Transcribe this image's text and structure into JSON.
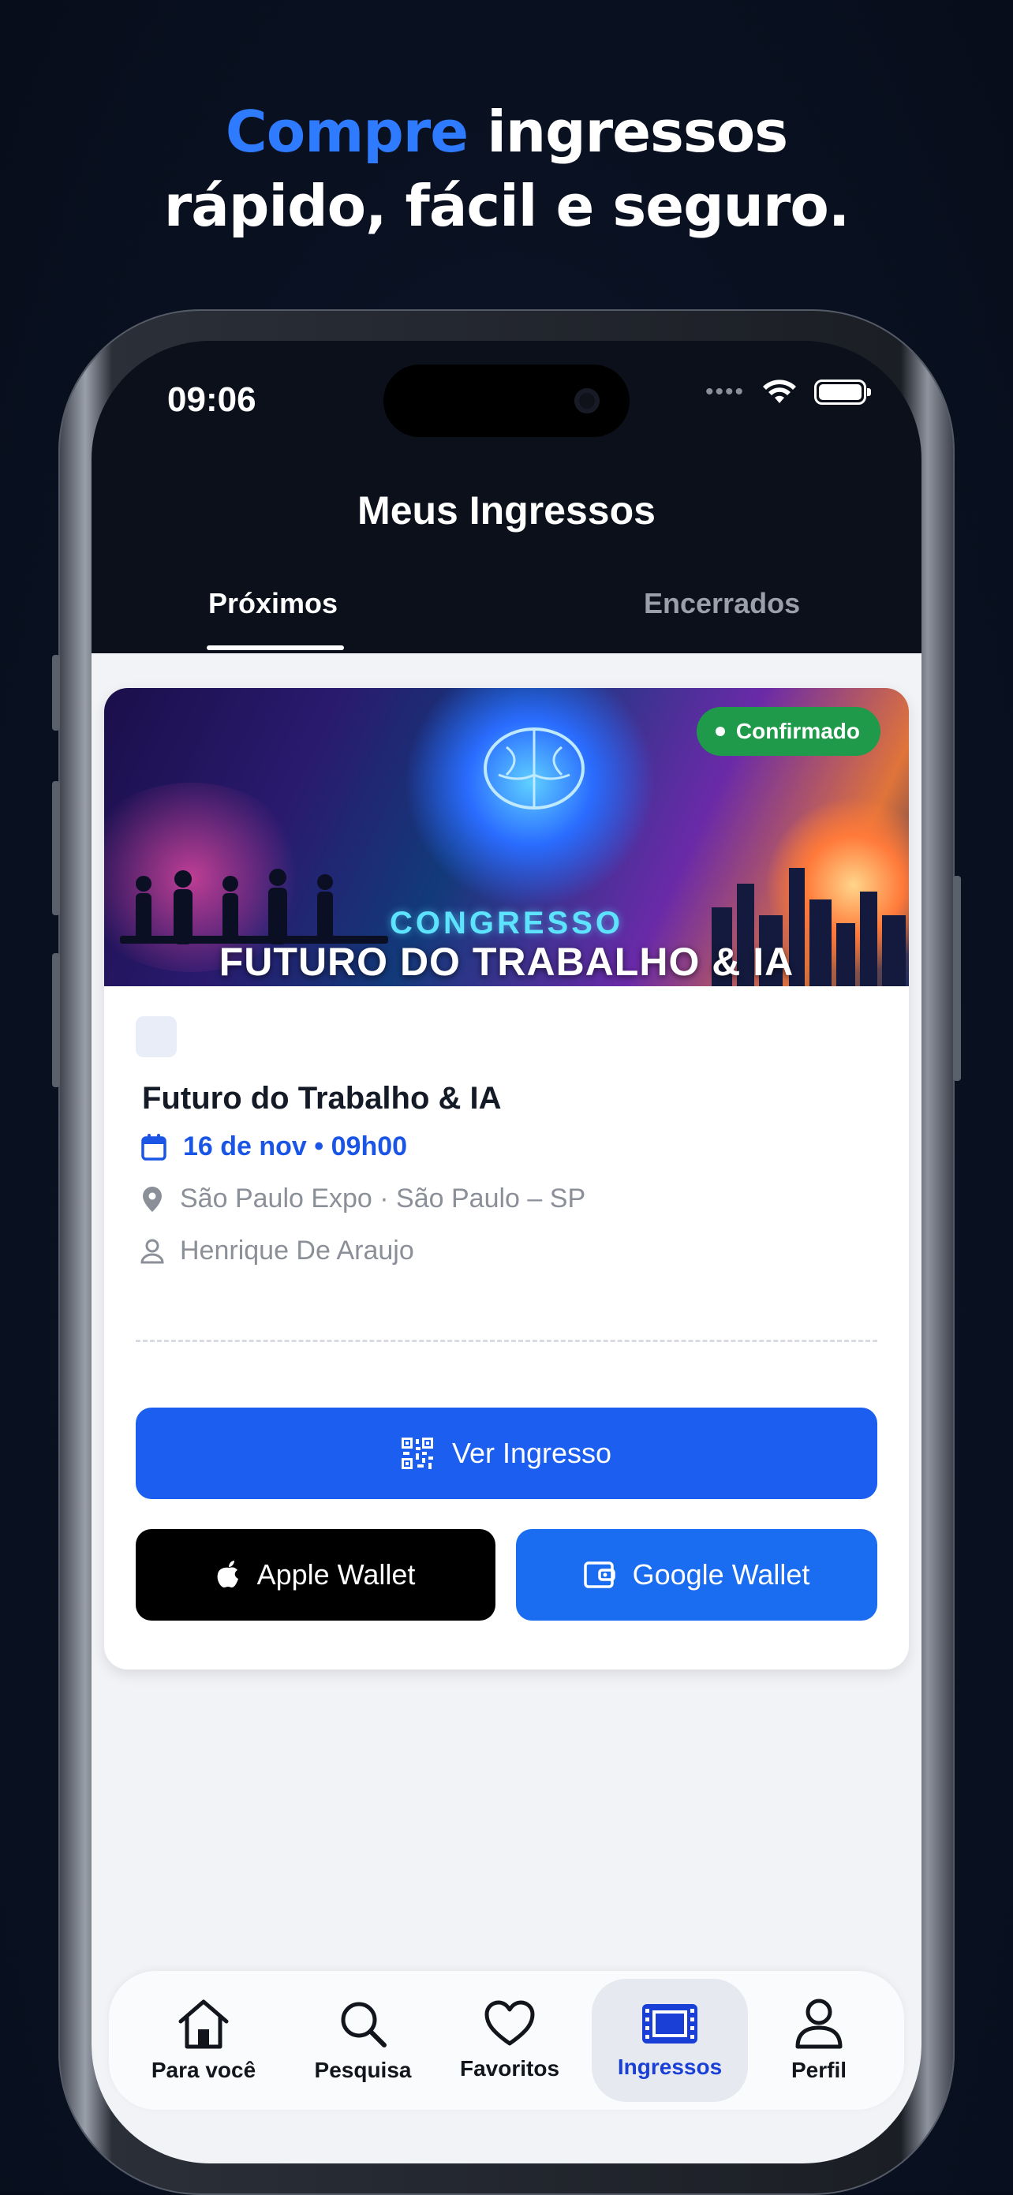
{
  "headline": {
    "accent": "Compre",
    "line1_rest": " ingressos",
    "line2": "rápido, fácil e seguro."
  },
  "status_bar": {
    "time": "09:06"
  },
  "header": {
    "title": "Meus Ingressos"
  },
  "tabs": [
    {
      "label": "Próximos",
      "active": true
    },
    {
      "label": "Encerrados",
      "active": false
    }
  ],
  "ticket": {
    "status": "Confirmado",
    "banner_subtitle": "CONGRESSO",
    "banner_title": "FUTURO DO TRABALHO & IA",
    "title": "Futuro do Trabalho & IA",
    "date": "16 de nov • 09h00",
    "venue": "São Paulo Expo · São Paulo – SP",
    "holder": "Henrique De Araujo",
    "view_ticket_label": "Ver Ingresso",
    "apple_wallet_label": "Apple Wallet",
    "google_wallet_label": "Google Wallet"
  },
  "nav": [
    {
      "label": "Para você",
      "icon": "home-icon"
    },
    {
      "label": "Pesquisa",
      "icon": "search-icon"
    },
    {
      "label": "Favoritos",
      "icon": "heart-icon"
    },
    {
      "label": "Ingressos",
      "icon": "ticket-icon",
      "active": true
    },
    {
      "label": "Perfil",
      "icon": "user-icon"
    }
  ],
  "colors": {
    "accent": "#2f7bff",
    "primary_button": "#1b5ef0",
    "confirmed": "#1f9a4a",
    "active_nav": "#1a3fd6"
  }
}
